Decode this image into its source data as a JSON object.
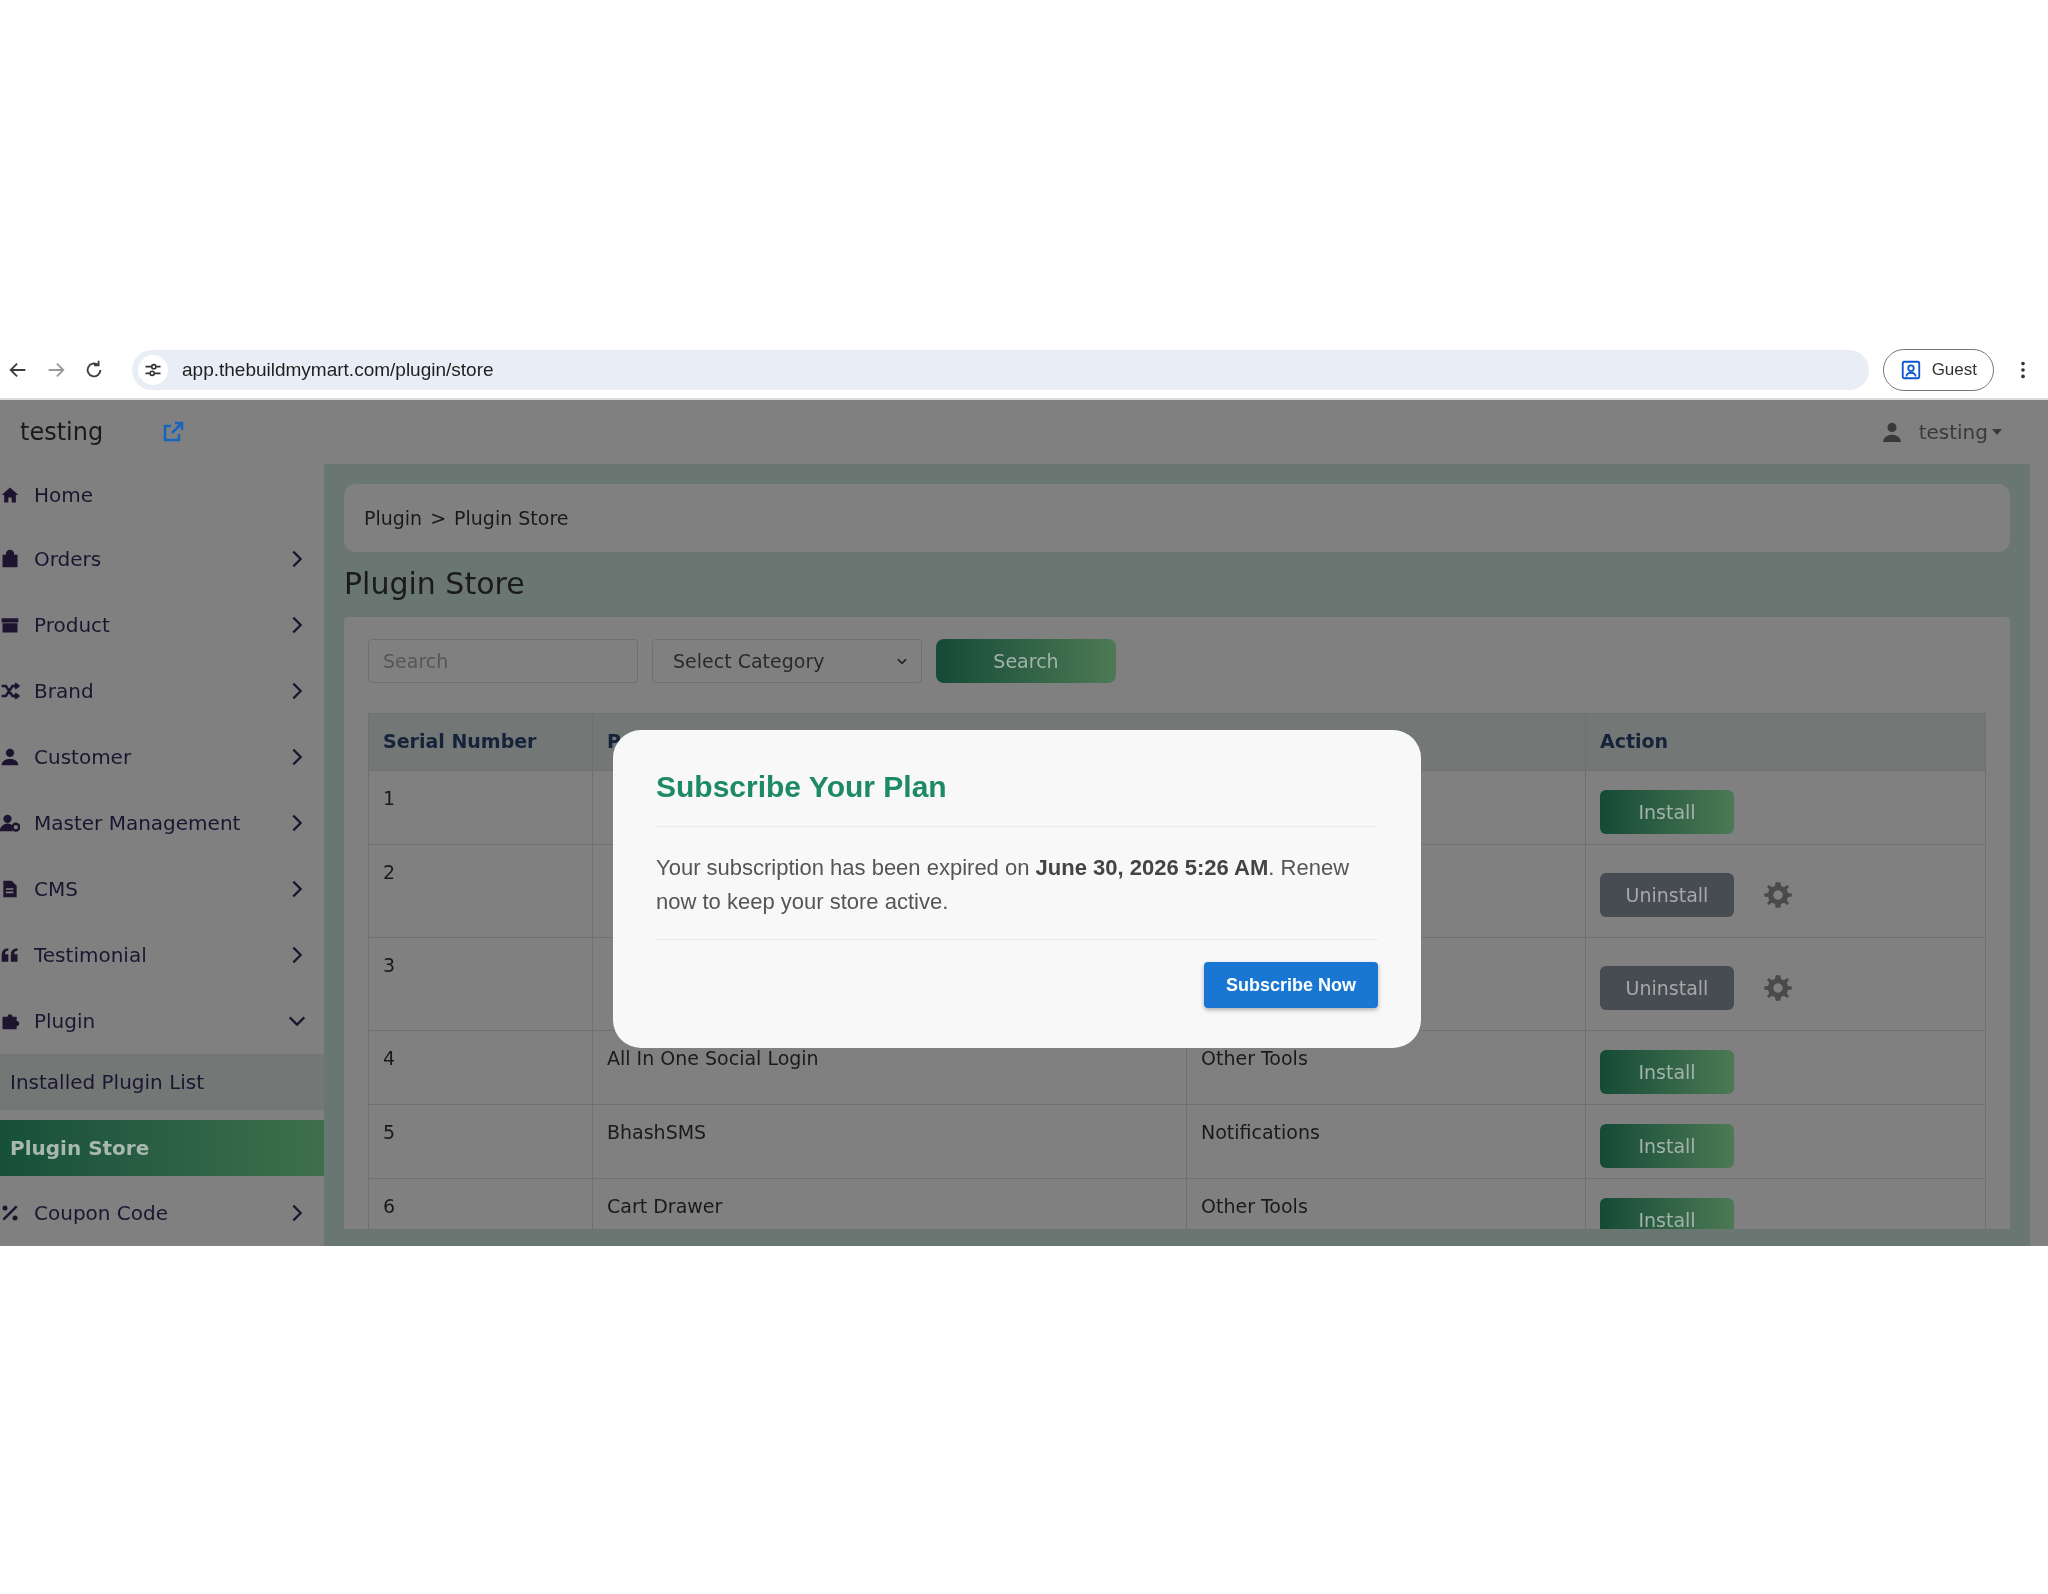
{
  "browser": {
    "url": "app.thebuildmymart.com/plugin/store",
    "profile": "Guest"
  },
  "topbar": {
    "brand": "testing",
    "user": "testing"
  },
  "sidebar": {
    "items": [
      {
        "label": "Home",
        "kind": "link"
      },
      {
        "label": "Orders",
        "kind": "group",
        "expanded": false
      },
      {
        "label": "Product",
        "kind": "group",
        "expanded": false
      },
      {
        "label": "Brand",
        "kind": "group",
        "expanded": false
      },
      {
        "label": "Customer",
        "kind": "group",
        "expanded": false
      },
      {
        "label": "Master Management",
        "kind": "group",
        "expanded": false
      },
      {
        "label": "CMS",
        "kind": "group",
        "expanded": false
      },
      {
        "label": "Testimonial",
        "kind": "group",
        "expanded": false
      },
      {
        "label": "Plugin",
        "kind": "group",
        "expanded": true,
        "children": [
          {
            "label": "Installed Plugin List",
            "selected": false
          },
          {
            "label": "Plugin Store",
            "selected": true
          }
        ]
      },
      {
        "label": "Coupon Code",
        "kind": "group",
        "expanded": false
      }
    ]
  },
  "breadcrumb": {
    "items": [
      "Plugin",
      "Plugin Store"
    ],
    "separator": ">"
  },
  "page_title": "Plugin Store",
  "filters": {
    "search": {
      "placeholder": "Search"
    },
    "category": {
      "value": "Select Category"
    },
    "button": "Search"
  },
  "table": {
    "columns": [
      "Serial Number",
      "P",
      "Action"
    ],
    "rows": [
      {
        "serial": "1",
        "action": {
          "kind": "install",
          "label": "Install"
        },
        "settings": false
      },
      {
        "serial": "2",
        "action": {
          "kind": "uninstall",
          "label": "Uninstall"
        },
        "settings": true
      },
      {
        "serial": "3",
        "action": {
          "kind": "uninstall",
          "label": "Uninstall"
        },
        "settings": true
      },
      {
        "serial": "4",
        "name": "All In One Social Login",
        "category": "Other Tools",
        "action": {
          "kind": "install",
          "label": "Install"
        },
        "settings": false
      },
      {
        "serial": "5",
        "name": "BhashSMS",
        "category": "Notifications",
        "action": {
          "kind": "install",
          "label": "Install"
        },
        "settings": false
      },
      {
        "serial": "6",
        "name": "Cart Drawer",
        "category": "Other Tools",
        "action": {
          "kind": "install",
          "label": "Install"
        },
        "settings": false
      }
    ]
  },
  "modal": {
    "title": "Subscribe Your Plan",
    "message": "Your subscription has been expired on **June 30, 2026 5:26 AM**. Renew now to keep your store active.",
    "button": "Subscribe Now"
  }
}
